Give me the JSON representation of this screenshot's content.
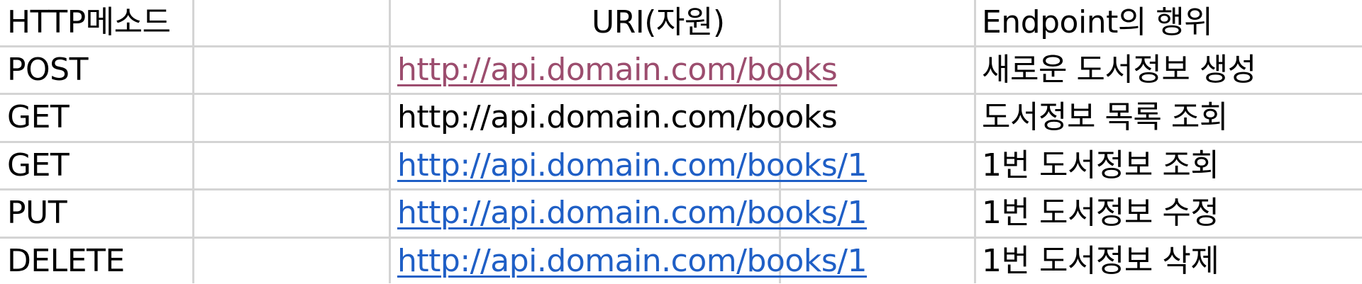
{
  "table": {
    "header": {
      "method": "HTTP메소드",
      "uri": "URI(자원)",
      "endpoint": "Endpoint의 행위"
    },
    "rows": [
      {
        "method": "POST",
        "uri": "http://api.domain.com/books",
        "uri_color": "#9c4d6e",
        "endpoint": "새로운 도서정보 생성"
      },
      {
        "method": "GET",
        "uri": "http://api.domain.com/books",
        "uri_color": "#000000",
        "endpoint": "도서정보 목록 조회"
      },
      {
        "method": "GET",
        "uri": "http://api.domain.com/books/1",
        "uri_color": "#1f5fc6",
        "endpoint": "1번 도서정보 조회"
      },
      {
        "method": "PUT",
        "uri": "http://api.domain.com/books/1",
        "uri_color": "#1f5fc6",
        "endpoint": "1번 도서정보 수정"
      },
      {
        "method": "DELETE",
        "uri": "http://api.domain.com/books/1",
        "uri_color": "#1f5fc6",
        "endpoint": "1번 도서정보 삭제"
      }
    ]
  }
}
